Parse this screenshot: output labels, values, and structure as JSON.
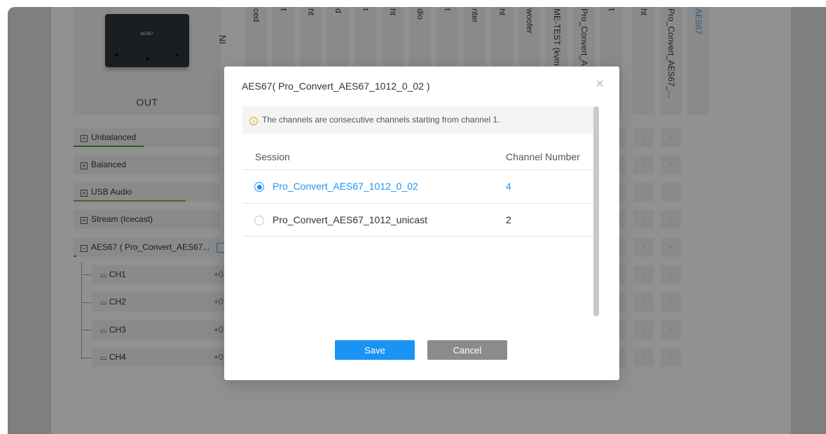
{
  "matrix": {
    "out_label": "OUT",
    "in_label": "IN",
    "device_brand": "AES67",
    "column_headers": [
      "ced",
      "t",
      "ht",
      "d",
      "t",
      "ht",
      "dio",
      "t",
      "nter",
      "ht",
      "woofer",
      "ME-TEST (kvm-l",
      "Pro_Convert_AE",
      "t",
      "ht",
      "Pro_Convert_AES67_...",
      "AES67"
    ],
    "groups": [
      {
        "label": "Unbalanced",
        "toggle": "+"
      },
      {
        "label": "Balanced",
        "toggle": "+"
      },
      {
        "label": "USB Audio",
        "toggle": "+"
      },
      {
        "label": "Stream (Icecast)",
        "toggle": "+"
      },
      {
        "label": "AES67 ( Pro_Convert_AES67...",
        "toggle": "−"
      }
    ],
    "channels": [
      {
        "label": "CH1",
        "gain": "+0"
      },
      {
        "label": "CH2",
        "gain": "+0"
      },
      {
        "label": "CH3",
        "gain": "+0"
      },
      {
        "label": "CH4",
        "gain": "+0"
      }
    ],
    "cell_label": "-"
  },
  "dialog": {
    "title": "AES67( Pro_Convert_AES67_1012_0_02 )",
    "close_glyph": "×",
    "notice": "The channels are consecutive channels starting from channel 1.",
    "headers": {
      "session": "Session",
      "channel_number": "Channel Number"
    },
    "rows": [
      {
        "session": "Pro_Convert_AES67_1012_0_02",
        "channel_number": "4",
        "selected": true
      },
      {
        "session": "Pro_Convert_AES67_1012_unicast",
        "channel_number": "2",
        "selected": false
      }
    ],
    "save_label": "Save",
    "cancel_label": "Cancel"
  },
  "colors": {
    "accent": "#1a93f5",
    "cancel": "#8b8b8b",
    "warning": "#f0a020"
  },
  "icons": [
    "info-icon",
    "close-icon",
    "headphone-icon",
    "edit-icon",
    "expand-icon",
    "collapse-icon",
    "radio-icon"
  ]
}
